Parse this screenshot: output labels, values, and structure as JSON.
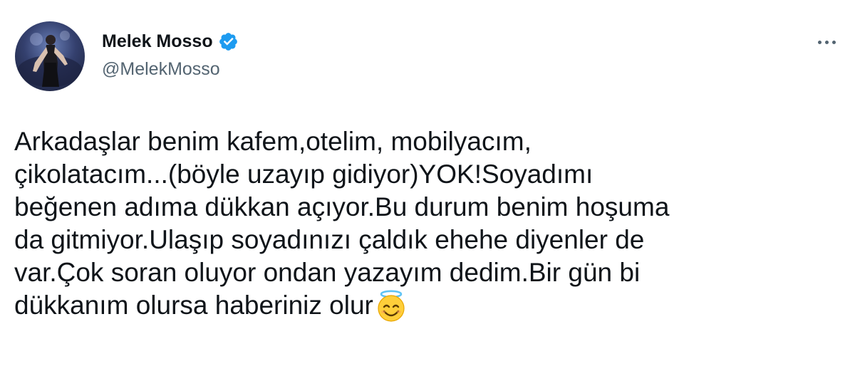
{
  "tweet": {
    "author": {
      "display_name": "Melek Mosso",
      "handle": "@MelekMosso",
      "verified": true,
      "avatar_icon": "profile-photo"
    },
    "menu_icon": "more-horizontal-icon",
    "text_lines": [
      "Arkadaşlar benim kafem,otelim, mobilyacım,",
      "çikolatacım...(böyle uzayıp gidiyor)YOK!Soyadımı",
      "beğenen adıma dükkan açıyor.Bu durum benim hoşuma",
      "da gitmiyor.Ulaşıp soyadınızı çaldık ehehe diyenler de",
      "var.Çok soran oluyor ondan yazayım dedim.Bir gün bi",
      "dükkanım olursa haberiniz olur"
    ],
    "trailing_emoji": "smiling-face-with-halo",
    "colors": {
      "verified_badge": "#1d9bf0",
      "text": "#0f1419",
      "secondary_text": "#536471"
    }
  }
}
